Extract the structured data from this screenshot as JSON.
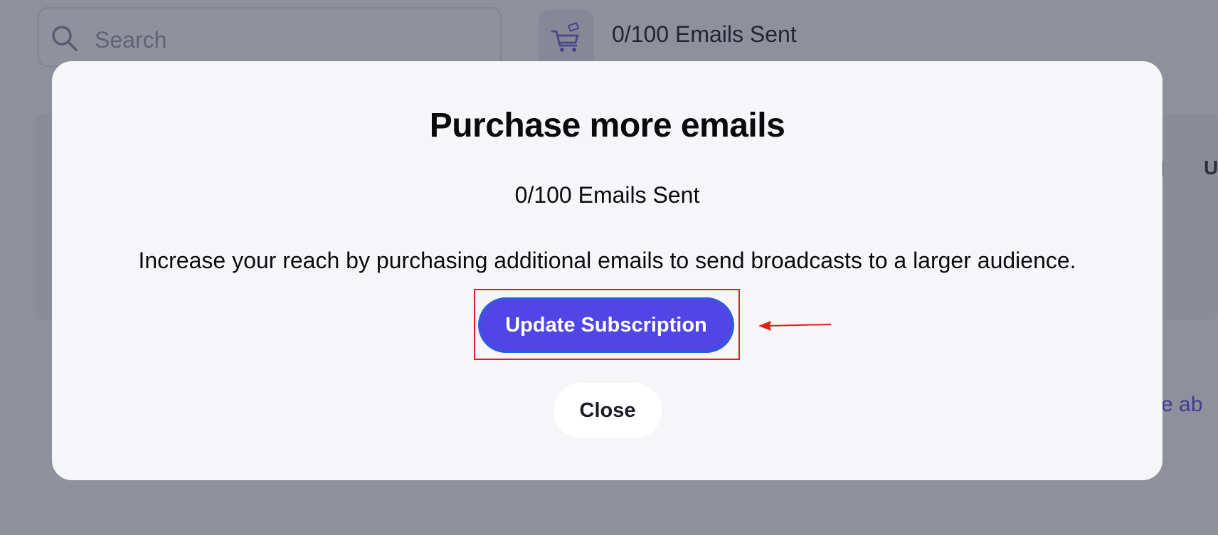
{
  "background": {
    "search": {
      "placeholder": "Search"
    },
    "emails_sent": "0/100 Emails Sent",
    "fragments": {
      "tab_letter": "U",
      "link_text": "re ab"
    }
  },
  "modal": {
    "title": "Purchase more emails",
    "count": "0/100 Emails Sent",
    "description": "Increase your reach by purchasing additional emails to send broadcasts to a larger audience.",
    "primary_button": "Update Subscription",
    "secondary_button": "Close"
  },
  "icons": {
    "search": "search-icon",
    "cart": "cart-icon",
    "arrow": "arrow-left-icon"
  },
  "colors": {
    "primary": "#4f46e5",
    "annotation": "#e31b1b",
    "overlay": "rgba(40,44,64,0.5)"
  }
}
